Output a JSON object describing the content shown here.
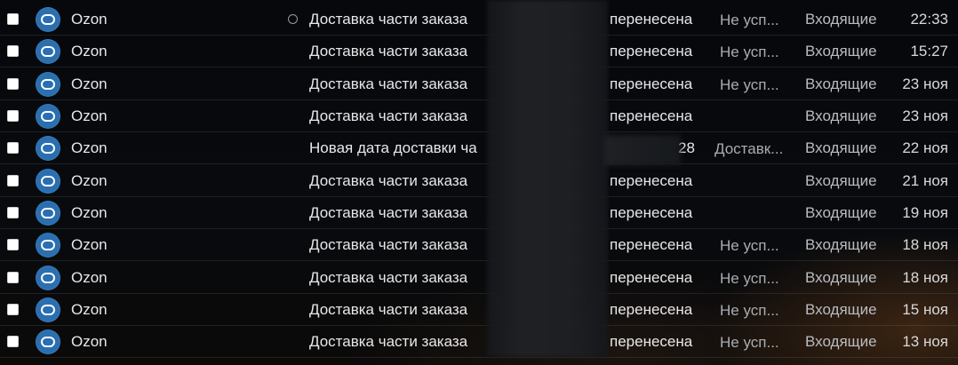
{
  "list": {
    "rows": [
      {
        "sender": "Ozon",
        "subject": "Доставка части заказа",
        "subject_end": "перенесена",
        "preview": "Не усп...",
        "folder": "Входящие",
        "date": "22:33",
        "unread": true
      },
      {
        "sender": "Ozon",
        "subject": "Доставка части заказа",
        "subject_end": "перенесена",
        "preview": "Не усп...",
        "folder": "Входящие",
        "date": "15:27",
        "unread": false
      },
      {
        "sender": "Ozon",
        "subject": "Доставка части заказа",
        "subject_end": "перенесена",
        "preview": "Не усп...",
        "folder": "Входящие",
        "date": "23 ноя",
        "unread": false
      },
      {
        "sender": "Ozon",
        "subject": "Доставка части заказа",
        "subject_end": "перенесена",
        "preview": "",
        "folder": "Входящие",
        "date": "23 ноя",
        "unread": false
      },
      {
        "sender": "Ozon",
        "subject": "Новая дата доставки ча",
        "subject_end": "28",
        "preview": "Доставк...",
        "folder": "Входящие",
        "date": "22 ноя",
        "unread": false
      },
      {
        "sender": "Ozon",
        "subject": "Доставка части заказа",
        "subject_end": "перенесена",
        "preview": "",
        "folder": "Входящие",
        "date": "21 ноя",
        "unread": false
      },
      {
        "sender": "Ozon",
        "subject": "Доставка части заказа",
        "subject_end": "перенесена",
        "preview": "",
        "folder": "Входящие",
        "date": "19 ноя",
        "unread": false
      },
      {
        "sender": "Ozon",
        "subject": "Доставка части заказа",
        "subject_end": "перенесена",
        "preview": "Не усп...",
        "folder": "Входящие",
        "date": "18 ноя",
        "unread": false
      },
      {
        "sender": "Ozon",
        "subject": "Доставка части заказа",
        "subject_end": "перенесена",
        "preview": "Не усп...",
        "folder": "Входящие",
        "date": "18 ноя",
        "unread": false
      },
      {
        "sender": "Ozon",
        "subject": "Доставка части заказа",
        "subject_end": "перенесена",
        "preview": "Не усп...",
        "folder": "Входящие",
        "date": "15 ноя",
        "unread": false
      },
      {
        "sender": "Ozon",
        "subject": "Доставка части заказа",
        "subject_end": "перенесена",
        "preview": "Не усп...",
        "folder": "Входящие",
        "date": "13 ноя",
        "unread": false
      }
    ]
  },
  "colors": {
    "avatar_bg": "#2a6fb0",
    "background": "#06080c",
    "text": "#e8e8e8",
    "muted_text": "#a9acb1"
  },
  "icons": {
    "avatar": "ozon-logo-icon",
    "unread": "unread-dot-icon",
    "select": "checkbox"
  }
}
